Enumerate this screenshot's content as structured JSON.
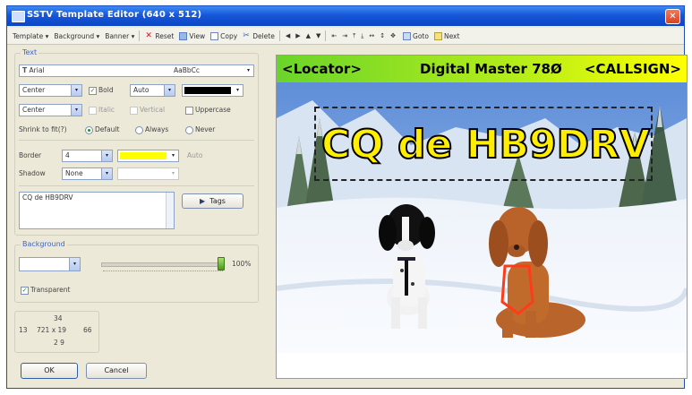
{
  "window": {
    "title": "SSTV Template Editor (640 x 512)",
    "close_glyph": "✕"
  },
  "toolbar": {
    "items": [
      {
        "label": "Template",
        "arrow": "▾"
      },
      {
        "label": "Background",
        "arrow": "▾"
      },
      {
        "label": "Banner",
        "arrow": "▾"
      }
    ],
    "reset": "Reset",
    "view": "View",
    "copy": "Copy",
    "delete": "Delete",
    "goto": "Goto",
    "next": "Next"
  },
  "text_group": {
    "legend": "Text",
    "font_name": "Arial",
    "font_preview": "AaBbCc",
    "h_align": "Center",
    "bold": "Bold",
    "size": "Auto",
    "v_align": "Center",
    "italic": "Italic",
    "vertical": "Vertical",
    "uppercase": "Uppercase",
    "shrink_label": "Shrink to fit(?)",
    "radio_default": "Default",
    "radio_always": "Always",
    "radio_never": "Never",
    "border_label": "Border",
    "border_value": "4",
    "border_color": "#ffff00",
    "border_extra": "Auto",
    "shadow_label": "Shadow",
    "shadow_value": "None",
    "text_value": "CQ de HB9DRV",
    "tags_button": "Tags"
  },
  "background_group": {
    "legend": "Background",
    "opacity": "100%",
    "transparent": "Transparent"
  },
  "position": {
    "top": "34",
    "left": "13",
    "size": "721 x 19",
    "right": "66",
    "bottom": "2 9"
  },
  "buttons": {
    "ok": "OK",
    "cancel": "Cancel"
  },
  "banner": {
    "left": "<Locator>",
    "center": "Digital Master 78Ø",
    "right": "<CALLSIGN>"
  },
  "overlay_text": "CQ de HB9DRV",
  "colors": {
    "banner_start": "#6ad42a",
    "banner_end": "#ffff00",
    "text_fill": "#ffee00",
    "title_blue": "#1757d9"
  }
}
